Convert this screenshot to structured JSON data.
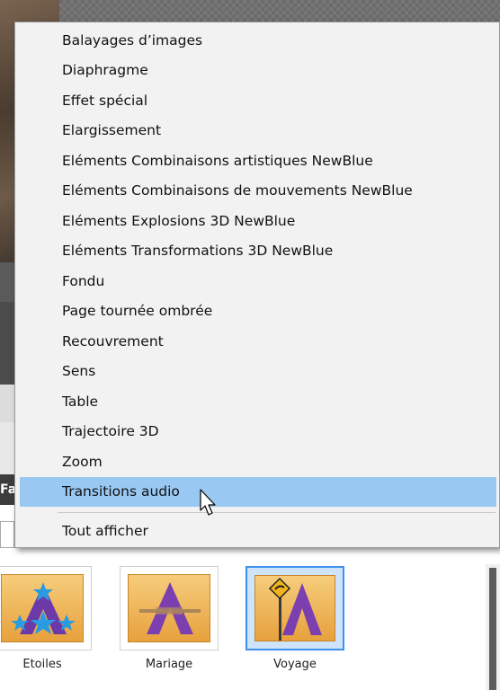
{
  "menu": {
    "items": [
      {
        "label": "Balayages d’images"
      },
      {
        "label": "Diaphragme"
      },
      {
        "label": "Effet spécial"
      },
      {
        "label": "Elargissement"
      },
      {
        "label": "Eléments Combinaisons artistiques NewBlue"
      },
      {
        "label": "Eléments Combinaisons de mouvements NewBlue"
      },
      {
        "label": "Eléments Explosions 3D NewBlue"
      },
      {
        "label": "Eléments Transformations 3D NewBlue"
      },
      {
        "label": "Fondu"
      },
      {
        "label": "Page tournée ombrée"
      },
      {
        "label": "Recouvrement"
      },
      {
        "label": "Sens"
      },
      {
        "label": "Table"
      },
      {
        "label": "Trajectoire 3D"
      },
      {
        "label": "Zoom"
      },
      {
        "label": "Transitions audio"
      }
    ],
    "highlighted_item": "Transitions audio",
    "show_all_label": "Tout afficher",
    "highlight_color": "#99c9f3"
  },
  "background": {
    "cut_off_label": "Fa"
  },
  "transitions": [
    {
      "label": "Etoiles",
      "icon": "etoiles-transition-icon"
    },
    {
      "label": "Mariage",
      "icon": "mariage-transition-icon"
    },
    {
      "label": "Voyage",
      "icon": "voyage-transition-icon",
      "selected": true
    }
  ],
  "colors": {
    "thumb_gradient_top": "#f6cd7c",
    "thumb_gradient_bottom": "#e7a13d",
    "letter_purple": "#7b3fb0",
    "selection_blue": "#3f8ff0"
  }
}
